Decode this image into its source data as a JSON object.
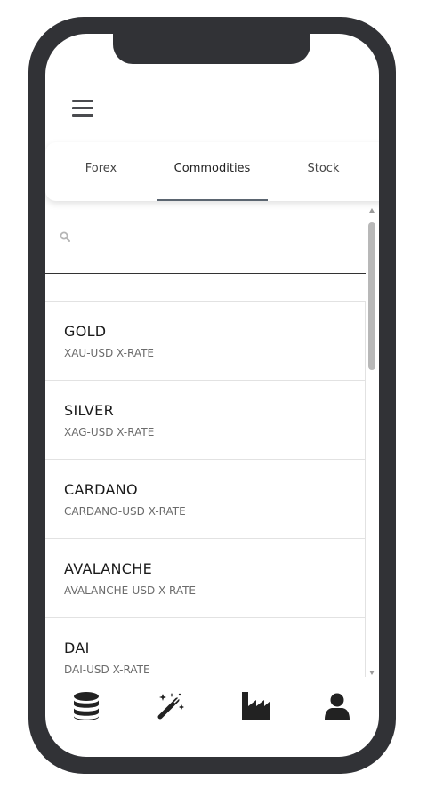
{
  "tabs": [
    {
      "label": "Forex"
    },
    {
      "label": "Commodities"
    },
    {
      "label": "Stock"
    }
  ],
  "active_tab": "Commodities",
  "search": {
    "placeholder": "",
    "value": ""
  },
  "items": [
    {
      "name": "GOLD",
      "rate": "XAU-USD X-RATE"
    },
    {
      "name": "SILVER",
      "rate": "XAG-USD X-RATE"
    },
    {
      "name": "CARDANO",
      "rate": "CARDANO-USD X-RATE"
    },
    {
      "name": "AVALANCHE",
      "rate": "AVALANCHE-USD X-RATE"
    },
    {
      "name": "DAI",
      "rate": "DAI-USD X-RATE"
    }
  ],
  "icons": {
    "menu": "hamburger-menu-icon",
    "search": "search-icon",
    "nav": [
      "database-icon",
      "magic-wand-icon",
      "industry-icon",
      "user-icon"
    ]
  },
  "colors": {
    "frame": "#313236",
    "active_tab_underline": "#5b6570",
    "icon": "#222222"
  }
}
